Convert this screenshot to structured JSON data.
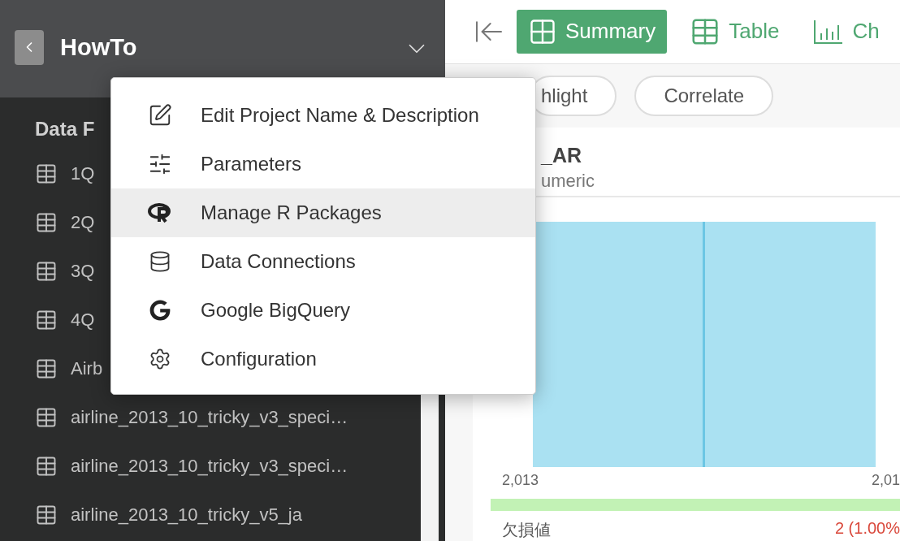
{
  "sidebar": {
    "project_title": "HowTo",
    "section_heading": "Data F",
    "items": [
      {
        "label": "1Q"
      },
      {
        "label": "2Q"
      },
      {
        "label": "3Q"
      },
      {
        "label": "4Q"
      },
      {
        "label": "Airb"
      },
      {
        "label": "airline_2013_10_tricky_v3_speci…"
      },
      {
        "label": "airline_2013_10_tricky_v3_speci…"
      },
      {
        "label": "airline_2013_10_tricky_v5_ja"
      }
    ]
  },
  "project_menu": {
    "items": [
      {
        "kind": "edit",
        "label": "Edit Project Name & Description",
        "highlighted": false
      },
      {
        "kind": "parameters",
        "label": "Parameters",
        "highlighted": false
      },
      {
        "kind": "r",
        "label": "Manage R Packages",
        "highlighted": true
      },
      {
        "kind": "database",
        "label": "Data Connections",
        "highlighted": false
      },
      {
        "kind": "google",
        "label": "Google BigQuery",
        "highlighted": false
      },
      {
        "kind": "config",
        "label": "Configuration",
        "highlighted": false
      }
    ]
  },
  "view_tabs": [
    {
      "kind": "summary",
      "label": "Summary",
      "selected": true
    },
    {
      "kind": "table",
      "label": "Table",
      "selected": false
    },
    {
      "kind": "chart",
      "label": "Ch",
      "selected": false
    }
  ],
  "chips": [
    "hlight",
    "Correlate"
  ],
  "column_card": {
    "name": "_AR",
    "type": "umeric",
    "axis_min": "2,013",
    "axis_max": "2,01",
    "missing_label": "欠損値",
    "missing_value": "2 (1.00%"
  }
}
